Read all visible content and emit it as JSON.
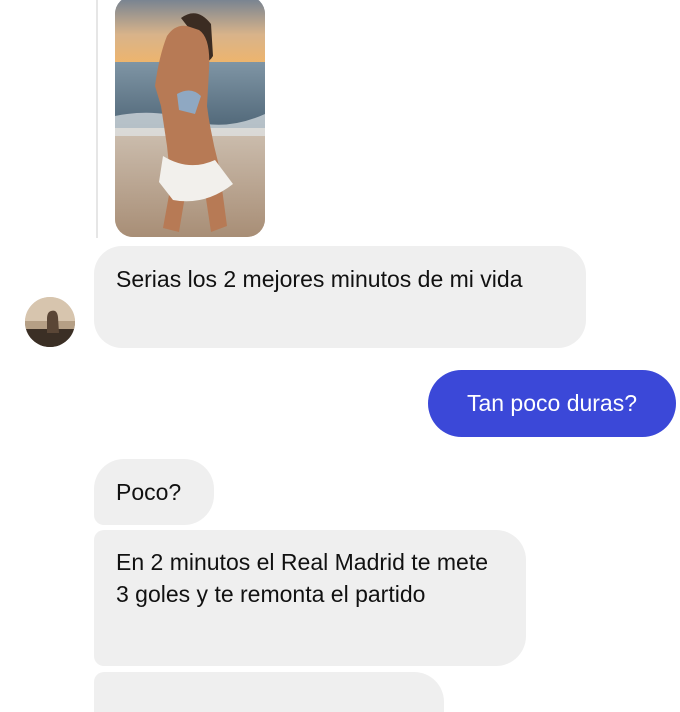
{
  "thread": {
    "photo_icon": "beach-photo",
    "avatar_icon": "contact-avatar",
    "colors": {
      "incoming_bubble": "#efefef",
      "outgoing_bubble": "#3b48d8",
      "outgoing_text": "#ffffff"
    },
    "messages": [
      {
        "direction": "incoming",
        "text": "Serias los 2 mejores minutos de mi vida"
      },
      {
        "direction": "outgoing",
        "text": "Tan poco duras?"
      },
      {
        "direction": "incoming",
        "text": "Poco?"
      },
      {
        "direction": "incoming",
        "text": "En 2 minutos el Real Madrid te mete 3 goles y te remonta el partido"
      },
      {
        "direction": "incoming",
        "text": ""
      }
    ]
  }
}
